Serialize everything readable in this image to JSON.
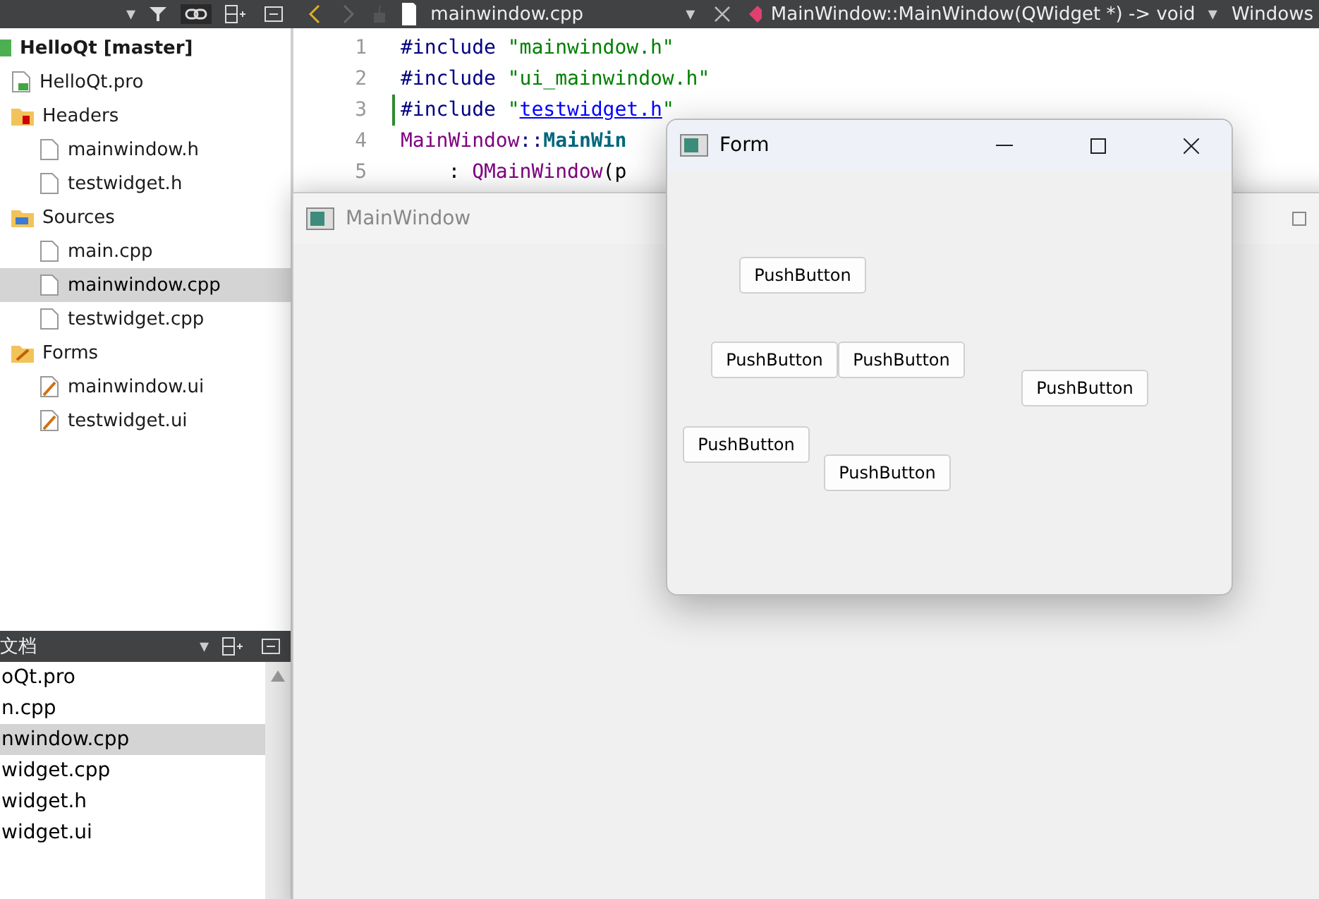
{
  "project_toolbar": {
    "dropdown": "▾"
  },
  "editor_toolbar": {
    "file": "mainwindow.cpp",
    "symbol": "MainWindow::MainWindow(QWidget *) -> void",
    "encoding": "Windows"
  },
  "project_tree": [
    {
      "label": "HelloQt [master]",
      "kind": "project",
      "selected": false,
      "children": [
        {
          "label": "HelloQt.pro",
          "kind": "pro",
          "selected": false
        },
        {
          "label": "Headers",
          "kind": "headers",
          "selected": false,
          "children": [
            {
              "label": "mainwindow.h",
              "kind": "file",
              "selected": false
            },
            {
              "label": "testwidget.h",
              "kind": "file",
              "selected": false
            }
          ]
        },
        {
          "label": "Sources",
          "kind": "sources",
          "selected": false,
          "children": [
            {
              "label": "main.cpp",
              "kind": "file",
              "selected": false
            },
            {
              "label": "mainwindow.cpp",
              "kind": "file",
              "selected": true
            },
            {
              "label": "testwidget.cpp",
              "kind": "file",
              "selected": false
            }
          ]
        },
        {
          "label": "Forms",
          "kind": "forms",
          "selected": false,
          "children": [
            {
              "label": "mainwindow.ui",
              "kind": "ui",
              "selected": false
            },
            {
              "label": "testwidget.ui",
              "kind": "ui",
              "selected": false
            }
          ]
        }
      ]
    }
  ],
  "open_documents": {
    "title": "文档",
    "items": [
      {
        "label": "oQt.pro",
        "selected": false
      },
      {
        "label": "n.cpp",
        "selected": false
      },
      {
        "label": "nwindow.cpp",
        "selected": true
      },
      {
        "label": "widget.cpp",
        "selected": false
      },
      {
        "label": "widget.h",
        "selected": false
      },
      {
        "label": "widget.ui",
        "selected": false
      }
    ]
  },
  "code": [
    {
      "number": "1",
      "changed": false,
      "tokens": [
        {
          "text": "#include ",
          "kind": "directive"
        },
        {
          "text": "\"mainwindow.h\"",
          "kind": "string"
        }
      ]
    },
    {
      "number": "2",
      "changed": false,
      "tokens": [
        {
          "text": "#include ",
          "kind": "directive"
        },
        {
          "text": "\"ui_mainwindow.h\"",
          "kind": "string"
        }
      ]
    },
    {
      "number": "3",
      "changed": true,
      "tokens": [
        {
          "text": "#include ",
          "kind": "directive"
        },
        {
          "text": "\"",
          "kind": "string"
        },
        {
          "text": "testwidget.h",
          "kind": "link"
        },
        {
          "text": "\"",
          "kind": "string"
        }
      ]
    },
    {
      "number": "4",
      "changed": false,
      "tokens": [
        {
          "text": "MainWindow",
          "kind": "type"
        },
        {
          "text": "::",
          "kind": "directive"
        },
        {
          "text": "MainWin",
          "kind": "function"
        }
      ]
    },
    {
      "number": "5",
      "changed": false,
      "tokens": [
        {
          "text": "    : ",
          "kind": "plain"
        },
        {
          "text": "QMainWindow",
          "kind": "type"
        },
        {
          "text": "(p",
          "kind": "plain"
        }
      ]
    }
  ],
  "main_window": {
    "title": "MainWindow"
  },
  "form_window": {
    "title": "Form",
    "buttons": [
      "PushButton",
      "PushButton",
      "PushButton",
      "PushButton",
      "PushButton",
      "PushButton"
    ]
  }
}
